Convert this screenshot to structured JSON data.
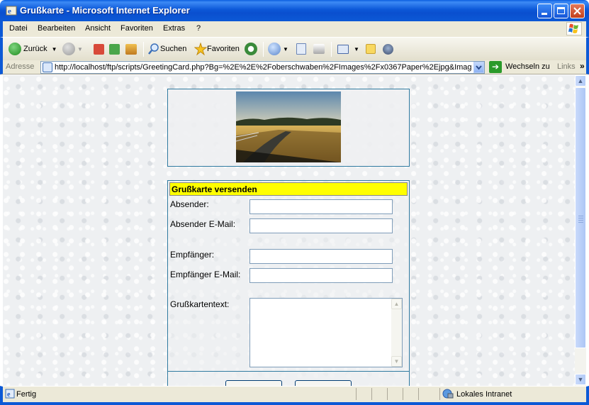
{
  "window": {
    "title": "Grußkarte - Microsoft Internet Explorer"
  },
  "menu": {
    "items": [
      "Datei",
      "Bearbeiten",
      "Ansicht",
      "Favoriten",
      "Extras",
      "?"
    ]
  },
  "toolbar": {
    "back_label": "Zurück",
    "search_label": "Suchen",
    "favorites_label": "Favoriten"
  },
  "address": {
    "label": "Adresse",
    "url": "http://localhost/ftp/scripts/GreetingCard.php?Bg=%2E%2E%2Foberschwaben%2FImages%2Fx0367Paper%2Ejpg&Image=",
    "go_label": "Wechseln zu",
    "links_label": "Links"
  },
  "form": {
    "header": "Grußkarte versenden",
    "sender_label": "Absender:",
    "sender_email_label": "Absender E-Mail:",
    "recipient_label": "Empfänger:",
    "recipient_email_label": "Empfänger E-Mail:",
    "text_label": "Grußkartentext:",
    "sender_value": "",
    "sender_email_value": "",
    "recipient_value": "",
    "recipient_email_value": "",
    "text_value": ""
  },
  "status": {
    "text": "Fertig",
    "zone": "Lokales Intranet"
  },
  "colors": {
    "titlebar": "#0a4fcf",
    "header_yellow": "#ffff00",
    "box_border": "#2f7aa0"
  }
}
